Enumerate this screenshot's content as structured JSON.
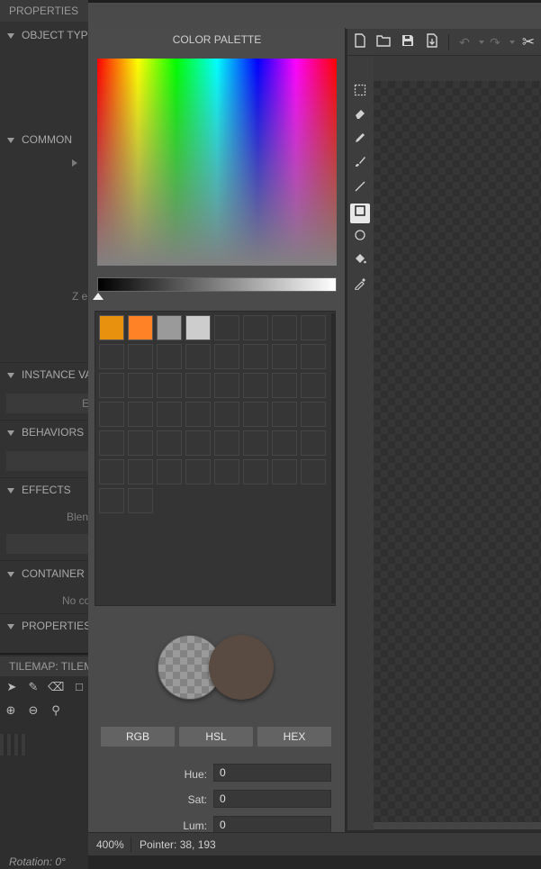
{
  "properties_panel": {
    "title": "PROPERTIES",
    "sections": [
      {
        "label": "OBJECT TYPE P"
      },
      {
        "label": "COMMON"
      },
      {
        "label": "INSTANCE VAI"
      },
      {
        "label": "BEHAVIORS"
      },
      {
        "label": "EFFECTS"
      },
      {
        "label": "CONTAINER"
      },
      {
        "label": "PROPERTIES"
      }
    ],
    "ghost_texts": {
      "z_elevation": "Z el",
      "instance_button": "E",
      "blend": "Blen",
      "container_none": "No co"
    }
  },
  "tilemap_panel": {
    "title": "TILEMAP: TILEMA",
    "rotation": "Rotation: 0°"
  },
  "palette": {
    "title": "COLOR PALETTE",
    "swatches": [
      "#e8910e",
      "#ff8326",
      "#9a9a9a",
      "#cdcdcd"
    ],
    "current_color": "#594a42",
    "modes": {
      "rgb": "RGB",
      "hsl": "HSL",
      "hex": "HEX"
    },
    "fields": {
      "hue_label": "Hue:",
      "hue_value": "0",
      "sat_label": "Sat:",
      "sat_value": "0",
      "lum_label": "Lum:",
      "lum_value": "0"
    }
  },
  "toolbar": {
    "icons": [
      "new-file-icon",
      "open-folder-icon",
      "save-icon",
      "export-icon",
      "undo-icon",
      "redo-icon",
      "cut-icon"
    ]
  },
  "tools": [
    "rect-select-icon",
    "eraser-icon",
    "pencil-icon",
    "brush-icon",
    "line-icon",
    "rectangle-icon",
    "ellipse-icon",
    "fill-bucket-icon",
    "eyedropper-icon"
  ],
  "status": {
    "zoom": "400%",
    "pointer": "Pointer: 38, 193"
  }
}
